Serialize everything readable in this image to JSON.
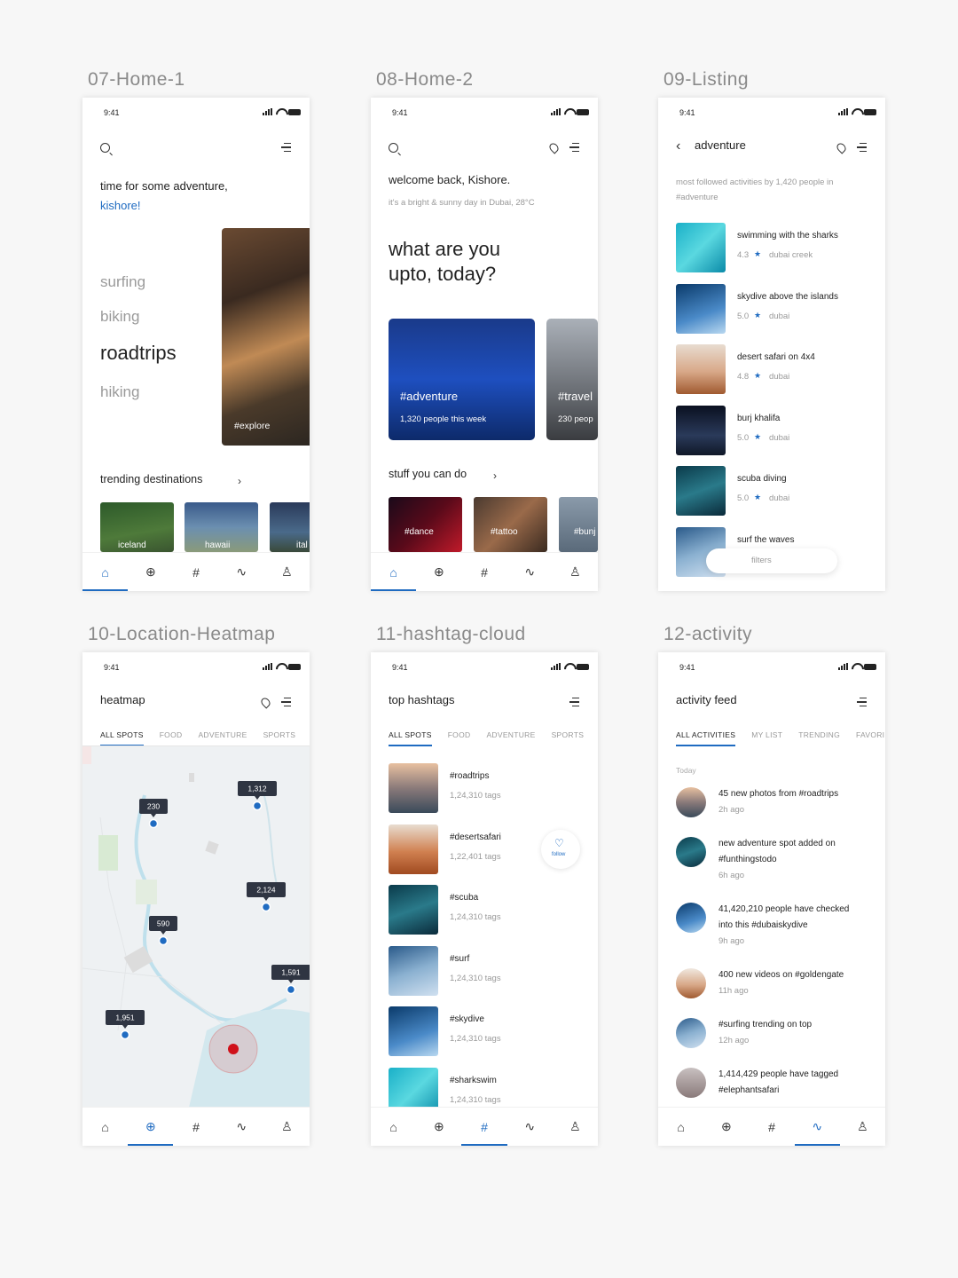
{
  "titles": {
    "s7": "07-Home-1",
    "s8": "08-Home-2",
    "s9": "09-Listing",
    "s10": "10-Location-Heatmap",
    "s11": "11-hashtag-cloud",
    "s12": "12-activity"
  },
  "status_time": "9:41",
  "s7": {
    "greeting": "time for some adventure,",
    "name": "kishore!",
    "activities": [
      "surfing",
      "biking",
      "roadtrips",
      "hiking"
    ],
    "card_tag": "#explore",
    "trending_label": "trending destinations",
    "destinations": [
      "iceland",
      "hawaii",
      "ital"
    ]
  },
  "s8": {
    "welcome": "welcome back, Kishore.",
    "weather": "it's a bright & sunny day in Dubai, 28°C",
    "question_line1": "what are you",
    "question_line2": "upto, today?",
    "cards": [
      {
        "tag": "#adventure",
        "count": "1,320 people this week"
      },
      {
        "tag": "#travel",
        "count": "230 peop"
      }
    ],
    "stuff_label": "stuff you can do",
    "stuff": [
      "#dance",
      "#tattoo",
      "#bunj"
    ]
  },
  "s9": {
    "title": "adventure",
    "subtitle": "most followed activities by 1,420 people in #adventure",
    "items": [
      {
        "name": "swimming with the sharks",
        "rating": "4.3",
        "place": "dubai creek"
      },
      {
        "name": "skydive above the islands",
        "rating": "5.0",
        "place": "dubai"
      },
      {
        "name": "desert safari on 4x4",
        "rating": "4.8",
        "place": "dubai"
      },
      {
        "name": "burj khalifa",
        "rating": "5.0",
        "place": "dubai"
      },
      {
        "name": "scuba diving",
        "rating": "5.0",
        "place": "dubai"
      },
      {
        "name": "surf the waves",
        "rating": "",
        "place": ""
      }
    ],
    "filters": "filters"
  },
  "s10": {
    "title": "heatmap",
    "tabs": [
      "ALL SPOTS",
      "FOOD",
      "ADVENTURE",
      "SPORTS"
    ],
    "markers": [
      "230",
      "1,312",
      "2,124",
      "590",
      "1,591",
      "1,951"
    ]
  },
  "s11": {
    "title": "top hashtags",
    "tabs": [
      "ALL SPOTS",
      "FOOD",
      "ADVENTURE",
      "SPORTS"
    ],
    "items": [
      {
        "tag": "#roadtrips",
        "count": "1,24,310 tags"
      },
      {
        "tag": "#desertsafari",
        "count": "1,22,401 tags"
      },
      {
        "tag": "#scuba",
        "count": "1,24,310 tags"
      },
      {
        "tag": "#surf",
        "count": "1,24,310 tags"
      },
      {
        "tag": "#skydive",
        "count": "1,24,310 tags"
      },
      {
        "tag": "#sharkswim",
        "count": "1,24,310 tags"
      }
    ],
    "follow": "follow"
  },
  "s12": {
    "title": "activity feed",
    "tabs": [
      "ALL ACTIVITIES",
      "MY LIST",
      "TRENDING",
      "FAVORI"
    ],
    "section": "Today",
    "items": [
      {
        "line1": "45 new photos from #roadtrips",
        "line2": "",
        "time": "2h ago"
      },
      {
        "line1": "new adventure spot added on",
        "line2": "#funthingstodo",
        "time": "6h ago"
      },
      {
        "line1": "41,420,210 people have checked",
        "line2": "into this #dubaiskydive",
        "time": "9h ago"
      },
      {
        "line1": "400 new videos on #goldengate",
        "line2": "",
        "time": "11h ago"
      },
      {
        "line1": "#surfing trending on top",
        "line2": "",
        "time": "12h ago"
      },
      {
        "line1": "1,414,429 people have tagged",
        "line2": "#elephantsafari",
        "time": ""
      }
    ]
  },
  "colors": {
    "accent": "#1f6bc1",
    "text": "#333333",
    "muted": "#999999",
    "bg": "#f7f7f7"
  }
}
